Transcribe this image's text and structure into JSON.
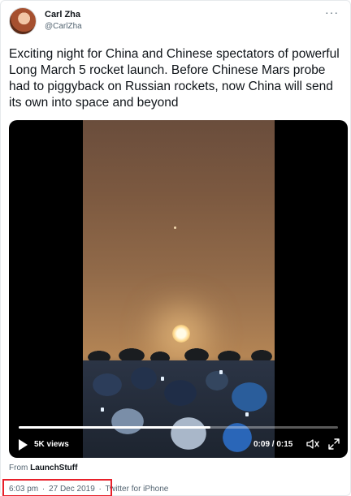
{
  "author": {
    "display_name": "Carl Zha",
    "handle": "@CarlZha"
  },
  "more_menu": "···",
  "tweet_text": "Exciting night for China and Chinese spectators of powerful Long March 5 rocket launch. Before Chinese Mars probe had to piggyback on Russian rockets, now China will send its own into space and beyond",
  "video": {
    "views": "5K views",
    "timestamp": "0:09 / 0:15",
    "progress_fraction": 0.6,
    "icons": [
      "play-icon",
      "speaker-icon",
      "expand-icon"
    ]
  },
  "source": {
    "prefix": "From",
    "name": "LaunchStuff"
  },
  "meta": {
    "time": "6:03 pm",
    "date": "27 Dec 2019",
    "separator": "·",
    "client": "Twitter for iPhone"
  },
  "colors": {
    "highlight_box": "#e8202a",
    "text_primary": "#0f1419",
    "text_secondary": "#536471"
  }
}
